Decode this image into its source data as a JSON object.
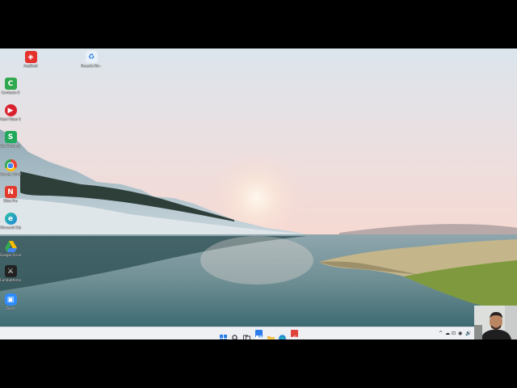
{
  "desktop": {
    "icons": [
      {
        "label": "AnyDesk",
        "icon": "anydesk-icon",
        "color": "#e5322d"
      },
      {
        "label": "Recycle Bin - Shortcut",
        "icon": "recycle-bin-icon",
        "color": "#e9f1f8"
      },
      {
        "label": "Camtasia 9",
        "icon": "camtasia-icon",
        "color": "#2fa84f"
      },
      {
        "label": "Total Video Conv...",
        "icon": "video-converter-icon",
        "color": "#d8212c"
      },
      {
        "label": "Sky Extractor 2021",
        "icon": "sky-extractor-icon",
        "color": "#22a85a"
      },
      {
        "label": "Google Chrome",
        "icon": "chrome-icon",
        "color": "#4285f4"
      },
      {
        "label": "Nitro Pro",
        "icon": "nitro-pro-icon",
        "color": "#e23b2e"
      },
      {
        "label": "Microsoft Edge",
        "icon": "edge-icon",
        "color": "#1e88d8"
      },
      {
        "label": "Google Drive",
        "icon": "google-drive-icon",
        "color": "#fbbc04"
      },
      {
        "label": "CombatArms",
        "icon": "combat-arms-icon",
        "color": "#222222"
      },
      {
        "label": "Zoom",
        "icon": "zoom-icon",
        "color": "#2d8cff"
      }
    ]
  },
  "taskbar": {
    "apps": [
      {
        "icon": "start-icon",
        "color": "#2b7de9"
      },
      {
        "icon": "search-icon",
        "color": "#333333"
      },
      {
        "icon": "task-view-icon",
        "color": "#444444"
      },
      {
        "icon": "widgets-icon",
        "color": "#2b7de9"
      },
      {
        "icon": "file-explorer-icon",
        "color": "#f2b632"
      },
      {
        "icon": "edge-icon",
        "color": "#1e88d8"
      },
      {
        "icon": "store-icon",
        "color": "#333333"
      },
      {
        "icon": "camtasia-icon",
        "color": "#e0443a"
      }
    ],
    "tray": [
      "^",
      "☁",
      "⊡",
      "◉",
      "🔊"
    ]
  },
  "colors": {
    "taskbar": "#eef0f4",
    "sky_top": "#dde6ec",
    "sky_horizon": "#f3d9d4",
    "water": "#5c7d85"
  }
}
